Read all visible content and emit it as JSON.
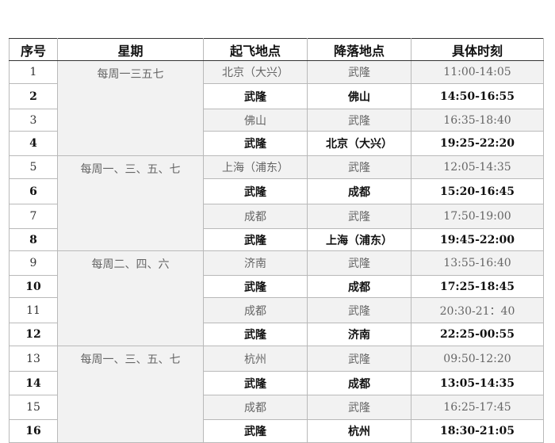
{
  "table": {
    "headers": [
      "序号",
      "星期",
      "起飞地点",
      "降落地点",
      "具体时刻"
    ],
    "groups": [
      {
        "week": "每周一三五七",
        "rows": [
          {
            "no": "1",
            "from": "北京（大兴）",
            "to": "武隆",
            "time": "11:00-14:05",
            "bold": false
          },
          {
            "no": "2",
            "from": "武隆",
            "to": "佛山",
            "time": "14:50-16:55",
            "bold": true
          },
          {
            "no": "3",
            "from": "佛山",
            "to": "武隆",
            "time": "16:35-18:40",
            "bold": false
          },
          {
            "no": "4",
            "from": "武隆",
            "to": "北京（大兴）",
            "time": "19:25-22:20",
            "bold": true
          }
        ]
      },
      {
        "week": "每周一、三、五、七",
        "rows": [
          {
            "no": "5",
            "from": "上海（浦东）",
            "to": "武隆",
            "time": "12:05-14:35",
            "bold": false
          },
          {
            "no": "6",
            "from": "武隆",
            "to": "成都",
            "time": "15:20-16:45",
            "bold": true
          },
          {
            "no": "7",
            "from": "成都",
            "to": "武隆",
            "time": "17:50-19:00",
            "bold": false
          },
          {
            "no": "8",
            "from": "武隆",
            "to": "上海（浦东）",
            "time": "19:45-22:00",
            "bold": true
          }
        ]
      },
      {
        "week": "每周二、四、六",
        "rows": [
          {
            "no": "9",
            "from": "济南",
            "to": "武隆",
            "time": "13:55-16:40",
            "bold": false
          },
          {
            "no": "10",
            "from": "武隆",
            "to": "成都",
            "time": "17:25-18:45",
            "bold": true
          },
          {
            "no": "11",
            "from": "成都",
            "to": "武隆",
            "time": "20:30-21：40",
            "bold": false
          },
          {
            "no": "12",
            "from": "武隆",
            "to": "济南",
            "time": "22:25-00:55",
            "bold": true
          }
        ]
      },
      {
        "week": "每周一、三、五、七",
        "rows": [
          {
            "no": "13",
            "from": "杭州",
            "to": "武隆",
            "time": "09:50-12:20",
            "bold": false
          },
          {
            "no": "14",
            "from": "武隆",
            "to": "成都",
            "time": "13:05-14:35",
            "bold": true
          },
          {
            "no": "15",
            "from": "成都",
            "to": "武隆",
            "time": "16:25-17:45",
            "bold": false
          },
          {
            "no": "16",
            "from": "武隆",
            "to": "杭州",
            "time": "18:30-21:05",
            "bold": true
          }
        ]
      }
    ]
  }
}
